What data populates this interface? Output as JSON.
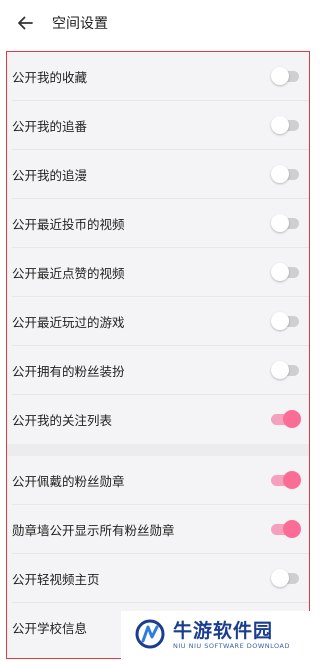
{
  "header": {
    "title": "空间设置"
  },
  "settings": [
    {
      "label": "公开我的收藏",
      "enabled": false
    },
    {
      "label": "公开我的追番",
      "enabled": false
    },
    {
      "label": "公开我的追漫",
      "enabled": false
    },
    {
      "label": "公开最近投币的视频",
      "enabled": false
    },
    {
      "label": "公开最近点赞的视频",
      "enabled": false
    },
    {
      "label": "公开最近玩过的游戏",
      "enabled": false
    },
    {
      "label": "公开拥有的粉丝装扮",
      "enabled": false
    },
    {
      "label": "公开我的关注列表",
      "enabled": true
    },
    {
      "label": "公开佩戴的粉丝勋章",
      "enabled": true
    },
    {
      "label": "勋章墙公开显示所有粉丝勋章",
      "enabled": true
    },
    {
      "label": "公开轻视频主页",
      "enabled": false
    },
    {
      "label": "公开学校信息",
      "enabled": false
    }
  ],
  "colors": {
    "accent": "#fb6c97",
    "highlight_border": "#e03a3e"
  },
  "watermark": {
    "name": "牛游软件园",
    "subtitle": "NIU NIU SOFTWARE DOWNLOAD"
  }
}
